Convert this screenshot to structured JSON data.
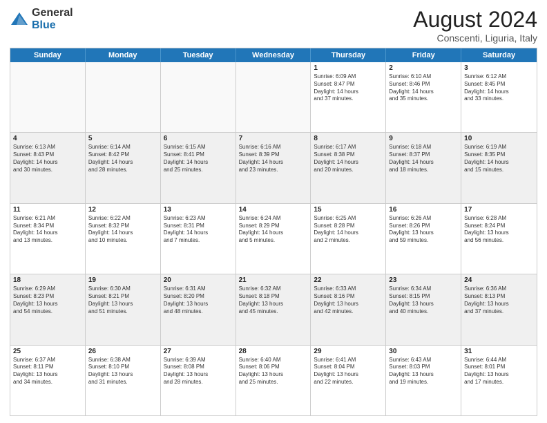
{
  "logo": {
    "general": "General",
    "blue": "Blue"
  },
  "title": "August 2024",
  "subtitle": "Conscenti, Liguria, Italy",
  "header_days": [
    "Sunday",
    "Monday",
    "Tuesday",
    "Wednesday",
    "Thursday",
    "Friday",
    "Saturday"
  ],
  "weeks": [
    [
      {
        "day": "",
        "empty": true,
        "text": ""
      },
      {
        "day": "",
        "empty": true,
        "text": ""
      },
      {
        "day": "",
        "empty": true,
        "text": ""
      },
      {
        "day": "",
        "empty": true,
        "text": ""
      },
      {
        "day": "1",
        "text": "Sunrise: 6:09 AM\nSunset: 8:47 PM\nDaylight: 14 hours\nand 37 minutes."
      },
      {
        "day": "2",
        "text": "Sunrise: 6:10 AM\nSunset: 8:46 PM\nDaylight: 14 hours\nand 35 minutes."
      },
      {
        "day": "3",
        "text": "Sunrise: 6:12 AM\nSunset: 8:45 PM\nDaylight: 14 hours\nand 33 minutes."
      }
    ],
    [
      {
        "day": "4",
        "text": "Sunrise: 6:13 AM\nSunset: 8:43 PM\nDaylight: 14 hours\nand 30 minutes."
      },
      {
        "day": "5",
        "text": "Sunrise: 6:14 AM\nSunset: 8:42 PM\nDaylight: 14 hours\nand 28 minutes."
      },
      {
        "day": "6",
        "text": "Sunrise: 6:15 AM\nSunset: 8:41 PM\nDaylight: 14 hours\nand 25 minutes."
      },
      {
        "day": "7",
        "text": "Sunrise: 6:16 AM\nSunset: 8:39 PM\nDaylight: 14 hours\nand 23 minutes."
      },
      {
        "day": "8",
        "text": "Sunrise: 6:17 AM\nSunset: 8:38 PM\nDaylight: 14 hours\nand 20 minutes."
      },
      {
        "day": "9",
        "text": "Sunrise: 6:18 AM\nSunset: 8:37 PM\nDaylight: 14 hours\nand 18 minutes."
      },
      {
        "day": "10",
        "text": "Sunrise: 6:19 AM\nSunset: 8:35 PM\nDaylight: 14 hours\nand 15 minutes."
      }
    ],
    [
      {
        "day": "11",
        "text": "Sunrise: 6:21 AM\nSunset: 8:34 PM\nDaylight: 14 hours\nand 13 minutes."
      },
      {
        "day": "12",
        "text": "Sunrise: 6:22 AM\nSunset: 8:32 PM\nDaylight: 14 hours\nand 10 minutes."
      },
      {
        "day": "13",
        "text": "Sunrise: 6:23 AM\nSunset: 8:31 PM\nDaylight: 14 hours\nand 7 minutes."
      },
      {
        "day": "14",
        "text": "Sunrise: 6:24 AM\nSunset: 8:29 PM\nDaylight: 14 hours\nand 5 minutes."
      },
      {
        "day": "15",
        "text": "Sunrise: 6:25 AM\nSunset: 8:28 PM\nDaylight: 14 hours\nand 2 minutes."
      },
      {
        "day": "16",
        "text": "Sunrise: 6:26 AM\nSunset: 8:26 PM\nDaylight: 13 hours\nand 59 minutes."
      },
      {
        "day": "17",
        "text": "Sunrise: 6:28 AM\nSunset: 8:24 PM\nDaylight: 13 hours\nand 56 minutes."
      }
    ],
    [
      {
        "day": "18",
        "text": "Sunrise: 6:29 AM\nSunset: 8:23 PM\nDaylight: 13 hours\nand 54 minutes."
      },
      {
        "day": "19",
        "text": "Sunrise: 6:30 AM\nSunset: 8:21 PM\nDaylight: 13 hours\nand 51 minutes."
      },
      {
        "day": "20",
        "text": "Sunrise: 6:31 AM\nSunset: 8:20 PM\nDaylight: 13 hours\nand 48 minutes."
      },
      {
        "day": "21",
        "text": "Sunrise: 6:32 AM\nSunset: 8:18 PM\nDaylight: 13 hours\nand 45 minutes."
      },
      {
        "day": "22",
        "text": "Sunrise: 6:33 AM\nSunset: 8:16 PM\nDaylight: 13 hours\nand 42 minutes."
      },
      {
        "day": "23",
        "text": "Sunrise: 6:34 AM\nSunset: 8:15 PM\nDaylight: 13 hours\nand 40 minutes."
      },
      {
        "day": "24",
        "text": "Sunrise: 6:36 AM\nSunset: 8:13 PM\nDaylight: 13 hours\nand 37 minutes."
      }
    ],
    [
      {
        "day": "25",
        "text": "Sunrise: 6:37 AM\nSunset: 8:11 PM\nDaylight: 13 hours\nand 34 minutes."
      },
      {
        "day": "26",
        "text": "Sunrise: 6:38 AM\nSunset: 8:10 PM\nDaylight: 13 hours\nand 31 minutes."
      },
      {
        "day": "27",
        "text": "Sunrise: 6:39 AM\nSunset: 8:08 PM\nDaylight: 13 hours\nand 28 minutes."
      },
      {
        "day": "28",
        "text": "Sunrise: 6:40 AM\nSunset: 8:06 PM\nDaylight: 13 hours\nand 25 minutes."
      },
      {
        "day": "29",
        "text": "Sunrise: 6:41 AM\nSunset: 8:04 PM\nDaylight: 13 hours\nand 22 minutes."
      },
      {
        "day": "30",
        "text": "Sunrise: 6:43 AM\nSunset: 8:03 PM\nDaylight: 13 hours\nand 19 minutes."
      },
      {
        "day": "31",
        "text": "Sunrise: 6:44 AM\nSunset: 8:01 PM\nDaylight: 13 hours\nand 17 minutes."
      }
    ]
  ]
}
